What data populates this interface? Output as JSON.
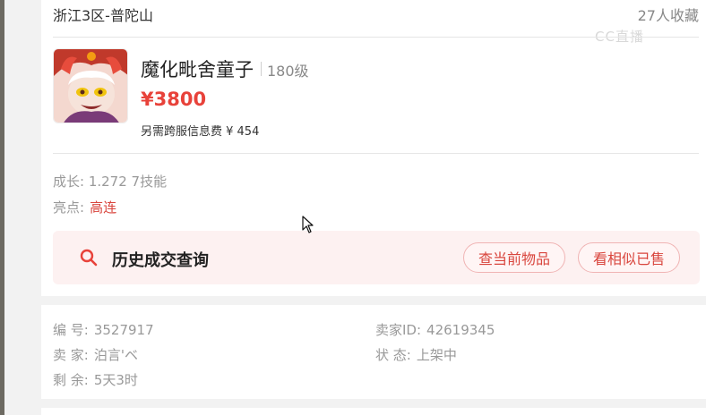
{
  "listing": {
    "server": "浙江3区-普陀山",
    "favorites": "27人收藏",
    "watermark": "CC直播",
    "item": {
      "name": "魔化毗舍童子",
      "level": "180级",
      "price": "¥3800",
      "extra_fee": "另需跨服信息费 ¥ 454"
    },
    "growth": "成长: 1.272 7技能",
    "highlight": {
      "label": "亮点:",
      "value": "高连"
    },
    "history": {
      "title": "历史成交查询",
      "btn_current": "查当前物品",
      "btn_similar": "看相似已售"
    }
  },
  "details": {
    "id_label": "编 号:",
    "id_value": "3527917",
    "seller_id_label": "卖家ID:",
    "seller_id_value": "42619345",
    "seller_label": "卖 家:",
    "seller_value": "泊言'ベ",
    "status_label": "状 态:",
    "status_value": "上架中",
    "remaining_label": "剩 余:",
    "remaining_value": "5天3时"
  },
  "colors": {
    "accent": "#e8423a",
    "pill_bg": "#fff5f5",
    "history_bg": "#fdf1f1"
  },
  "icons": [
    "search-icon",
    "mouse-cursor-icon",
    "character-avatar"
  ]
}
